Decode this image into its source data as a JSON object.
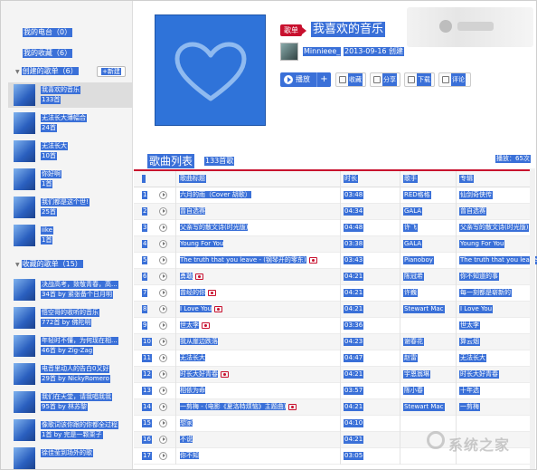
{
  "sidebar": {
    "my_radio": "我的电台（0）",
    "my_collect": "我的收藏（6）",
    "created_head": "创建的歌单（6）",
    "new_label": "+新建",
    "fav_head": "收藏的歌单（15）",
    "created": [
      {
        "name": "我喜欢的音乐",
        "count": "133首"
      },
      {
        "name": "无法长大薄幅合",
        "count": "24首"
      },
      {
        "name": "无法长大",
        "count": "10首"
      },
      {
        "name": "你好啊",
        "count": "1首"
      },
      {
        "name": "我们都是这个世!",
        "count": "25首"
      },
      {
        "name": "iike",
        "count": "1首"
      }
    ],
    "favorites": [
      {
        "name": "决战高考，致敬青春，高...",
        "count": "34首 by 紧张备个日月明"
      },
      {
        "name": "悟空哥的收听的音乐",
        "count": "772首 by 佛陀明"
      },
      {
        "name": "年轻时不懂，为何现在相...",
        "count": "46首 by Zig-Zag"
      },
      {
        "name": "电音里动人的告白0又好",
        "count": "29首 by NickyRomero"
      },
      {
        "name": "我们在天堂，请我唱我我",
        "count": "95首 by 林苏黎"
      },
      {
        "name": "像歌词该你跟的你都全过程",
        "count": "1首 by 完是一颗栗子"
      },
      {
        "name": "徐佳莹到场外的歌",
        "count": ""
      }
    ]
  },
  "header": {
    "tag": "歌单",
    "title": "我喜欢的音乐",
    "creator": "Minnieee_",
    "created": "2013-09-16 创建",
    "play_label": "播放",
    "add_label": "+",
    "collect_label": "收藏",
    "share_label": "分享",
    "download_label": "下载",
    "comment_label": "评论"
  },
  "list": {
    "title": "歌曲列表",
    "count": "133首歌",
    "play_count": "播放：65次",
    "columns": {
      "title": "歌曲标题",
      "time": "时长",
      "artist": "歌手",
      "album": "专辑"
    },
    "rows": [
      {
        "idx": "1",
        "title": "六月的雨（Cover 胡歌）",
        "mv": false,
        "time": "03:48",
        "artist": "RED格格",
        "album": "仙剑奇侠传"
      },
      {
        "idx": "2",
        "title": "曾自选赛",
        "mv": false,
        "time": "04:34",
        "artist": "GALA",
        "album": "曾自选赛"
      },
      {
        "idx": "3",
        "title": "父亲写的散文诗(时光版)",
        "mv": false,
        "time": "04:48",
        "artist": "许飞",
        "album": "父亲写的散文诗(时光版)"
      },
      {
        "idx": "4",
        "title": "Young For You",
        "mv": false,
        "time": "03:38",
        "artist": "GALA",
        "album": "Young For You"
      },
      {
        "idx": "5",
        "title": "The truth that you leave - (钢琴开的零东)",
        "mv": true,
        "time": "03:43",
        "artist": "Pianoboy",
        "album": "The truth that you leave"
      },
      {
        "idx": "6",
        "title": "勇敢",
        "mv": true,
        "time": "04:21",
        "artist": "陈冠希",
        "album": "你不知道的事"
      },
      {
        "idx": "7",
        "title": "曾经的你",
        "mv": true,
        "time": "04:21",
        "artist": "许巍",
        "album": "每一刻都是崭新的"
      },
      {
        "idx": "8",
        "title": "I Love You",
        "mv": true,
        "time": "04:21",
        "artist": "Stewart Mac",
        "album": "I Love You"
      },
      {
        "idx": "9",
        "title": "世太李",
        "mv": true,
        "time": "03:36",
        "artist": "",
        "album": "世太李"
      },
      {
        "idx": "10",
        "title": "我从崖边跌落",
        "mv": false,
        "time": "04:23",
        "artist": "谢春花",
        "album": "算云烟"
      },
      {
        "idx": "11",
        "title": "无法长大",
        "mv": false,
        "time": "04:47",
        "artist": "赵雷",
        "album": "无法长大"
      },
      {
        "idx": "12",
        "title": "时长大好青春",
        "mv": true,
        "time": "04:21",
        "artist": "宇恩翁琳",
        "album": "时长大好青春"
      },
      {
        "idx": "13",
        "title": "相依为命",
        "mv": false,
        "time": "03:57",
        "artist": "陈小春",
        "album": "十年选"
      },
      {
        "idx": "14",
        "title": "一剪梅 - (电影《夏洛特烦恼》主题曲)",
        "mv": true,
        "time": "04:21",
        "artist": "Stewart Mac",
        "album": "一剪梅"
      },
      {
        "idx": "15",
        "title": "想家",
        "mv": false,
        "time": "04:10",
        "artist": "",
        "album": ""
      },
      {
        "idx": "16",
        "title": "不说",
        "mv": false,
        "time": "04:21",
        "artist": "",
        "album": ""
      },
      {
        "idx": "17",
        "title": "你不知",
        "mv": false,
        "time": "03:05",
        "artist": "",
        "album": ""
      }
    ]
  },
  "watermark": {
    "text": "系统之家"
  }
}
